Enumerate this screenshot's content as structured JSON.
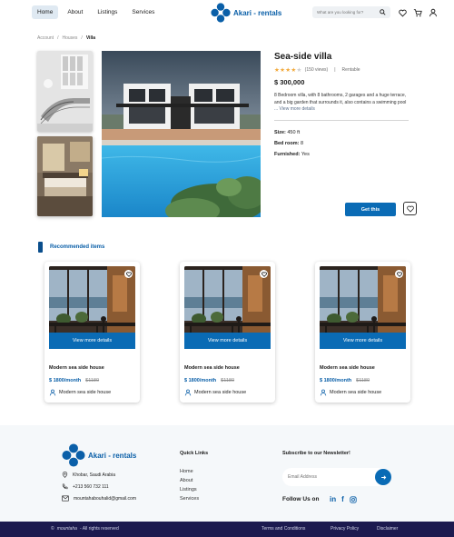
{
  "nav": {
    "links": [
      "Home",
      "About",
      "Listings",
      "Services"
    ],
    "brand": "Akari - rentals",
    "search_placeholder": "What are you looking for?"
  },
  "breadcrumb": [
    "Account",
    "Houses",
    "Villa"
  ],
  "property": {
    "title": "Sea-side villa",
    "rating_stars": 4,
    "reviews": "(150 views)",
    "separator": "|",
    "status": "Rentable",
    "price": "$ 300,000",
    "description": "8 Bedroom villa, with 8 bathrooms, 2 garages and a huge terrace, and a big garden that surrounds it, also contains a swimming pool",
    "more": "... View more details",
    "size_label": "Size:",
    "size_value": "450 ft",
    "bedroom_label": "Bed room:",
    "bedroom_value": "8",
    "furnished_label": "Furnished:",
    "furnished_value": "Yes",
    "cta": "Get this"
  },
  "recommended": {
    "title": "Recommended items",
    "items": [
      {
        "button": "View more details",
        "name": "Modern sea side house",
        "price": "$ 1800/month",
        "old_price": "$1180",
        "location": "Modern sea side house"
      },
      {
        "button": "View more details",
        "name": "Modern sea side house",
        "price": "$ 1800/month",
        "old_price": "$1180",
        "location": "Modern sea side house"
      },
      {
        "button": "View more details",
        "name": "Modern sea side house",
        "price": "$ 1800/month",
        "old_price": "$1180",
        "location": "Modern sea side house"
      }
    ]
  },
  "footer": {
    "brand": "Akari - rentals",
    "address": "Khobar, Saudi Arabia",
    "phone": "+213 560 732 111",
    "email": "mountahabouhalid@gmail.com",
    "quick_links_title": "Quick Links",
    "quick_links": [
      "Home",
      "About",
      "Listings",
      "Services"
    ],
    "newsletter_title": "Subscribe to our Newsletter!",
    "email_placeholder": "Email Address",
    "follow": "Follow Us on",
    "social": [
      "in",
      "f",
      "ig"
    ],
    "copyright_mark": "©",
    "owner": "mountaha",
    "rights": "- All rights reserved",
    "bottom_links": [
      "Terms and Conditions",
      "Privacy Policy",
      "Disclaimer"
    ]
  },
  "colors": {
    "primary": "#0a6bb5",
    "brand": "#0a5fa8",
    "star": "#f2a93b",
    "bottom_bar": "#1c1a4f"
  }
}
